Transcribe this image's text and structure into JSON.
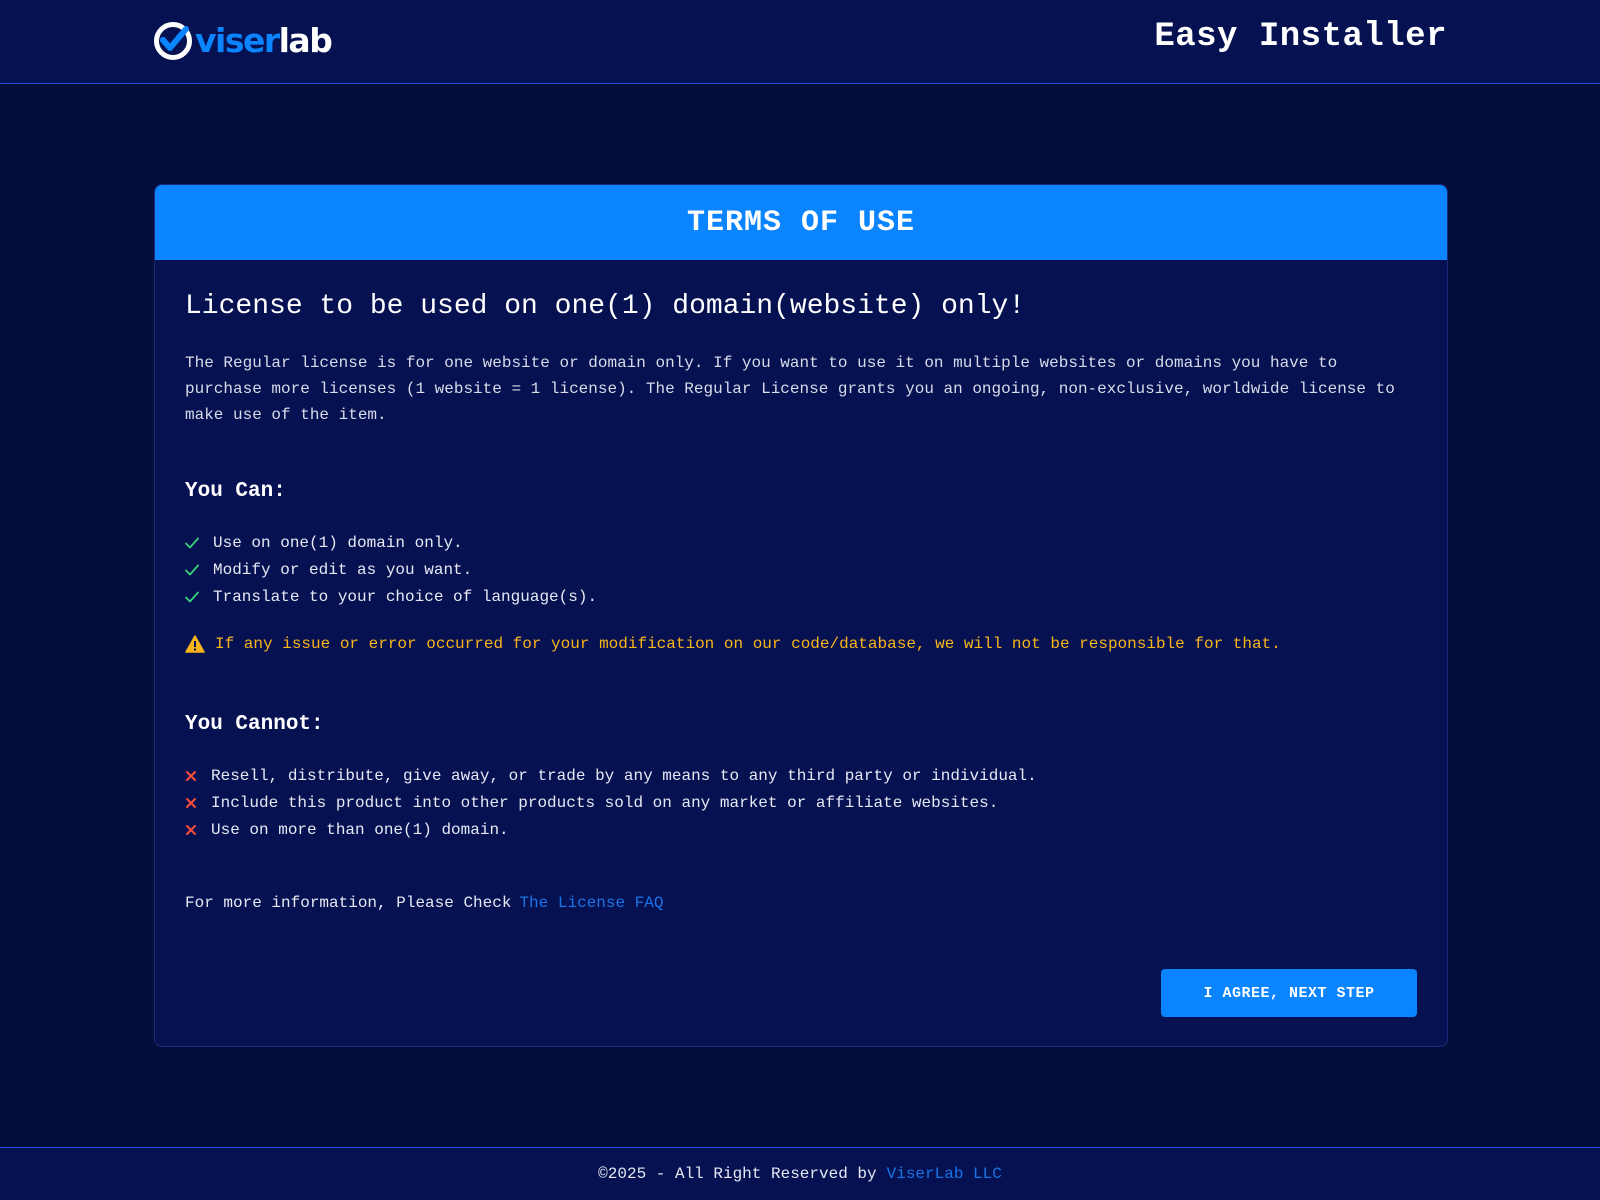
{
  "header": {
    "logo_part1": "viser",
    "logo_part2": "lab",
    "title": "Easy Installer"
  },
  "card": {
    "header_title": "TERMS OF USE",
    "license_title": "License to be used on one(1) domain(website) only!",
    "intro": "The Regular license is for one website or domain only. If you want to use it on multiple websites or domains you have to purchase more licenses (1 website = 1 license). The Regular License grants you an ongoing, non-exclusive, worldwide license to make use of the item.",
    "can_title": "You Can:",
    "can_items": [
      "Use on one(1) domain only.",
      "Modify or edit as you want.",
      "Translate to your choice of language(s)."
    ],
    "warning": "If any issue or error occurred for your modification on our code/database, we will not be responsible for that.",
    "cannot_title": "You Cannot:",
    "cannot_items": [
      "Resell, distribute, give away, or trade by any means to any third party or individual.",
      "Include this product into other products sold on any market or affiliate websites.",
      "Use on more than one(1) domain."
    ],
    "more_info_text": "For more information, Please Check",
    "more_info_link": "The License FAQ",
    "agree_button": "I AGREE, NEXT STEP"
  },
  "footer": {
    "text": "©2025 - All Right Reserved by",
    "link": "ViserLab LLC"
  },
  "icons": {
    "check": "check-icon",
    "cross": "close-icon",
    "warning": "warning-icon",
    "logo": "viserlab-logo-icon"
  },
  "colors": {
    "background": "#050d3b",
    "panel": "#061152",
    "accent": "#0a84ff",
    "link": "#1a74e8",
    "check": "#3ad07a",
    "cross": "#ff4b3a",
    "warning": "#f8b51b"
  }
}
